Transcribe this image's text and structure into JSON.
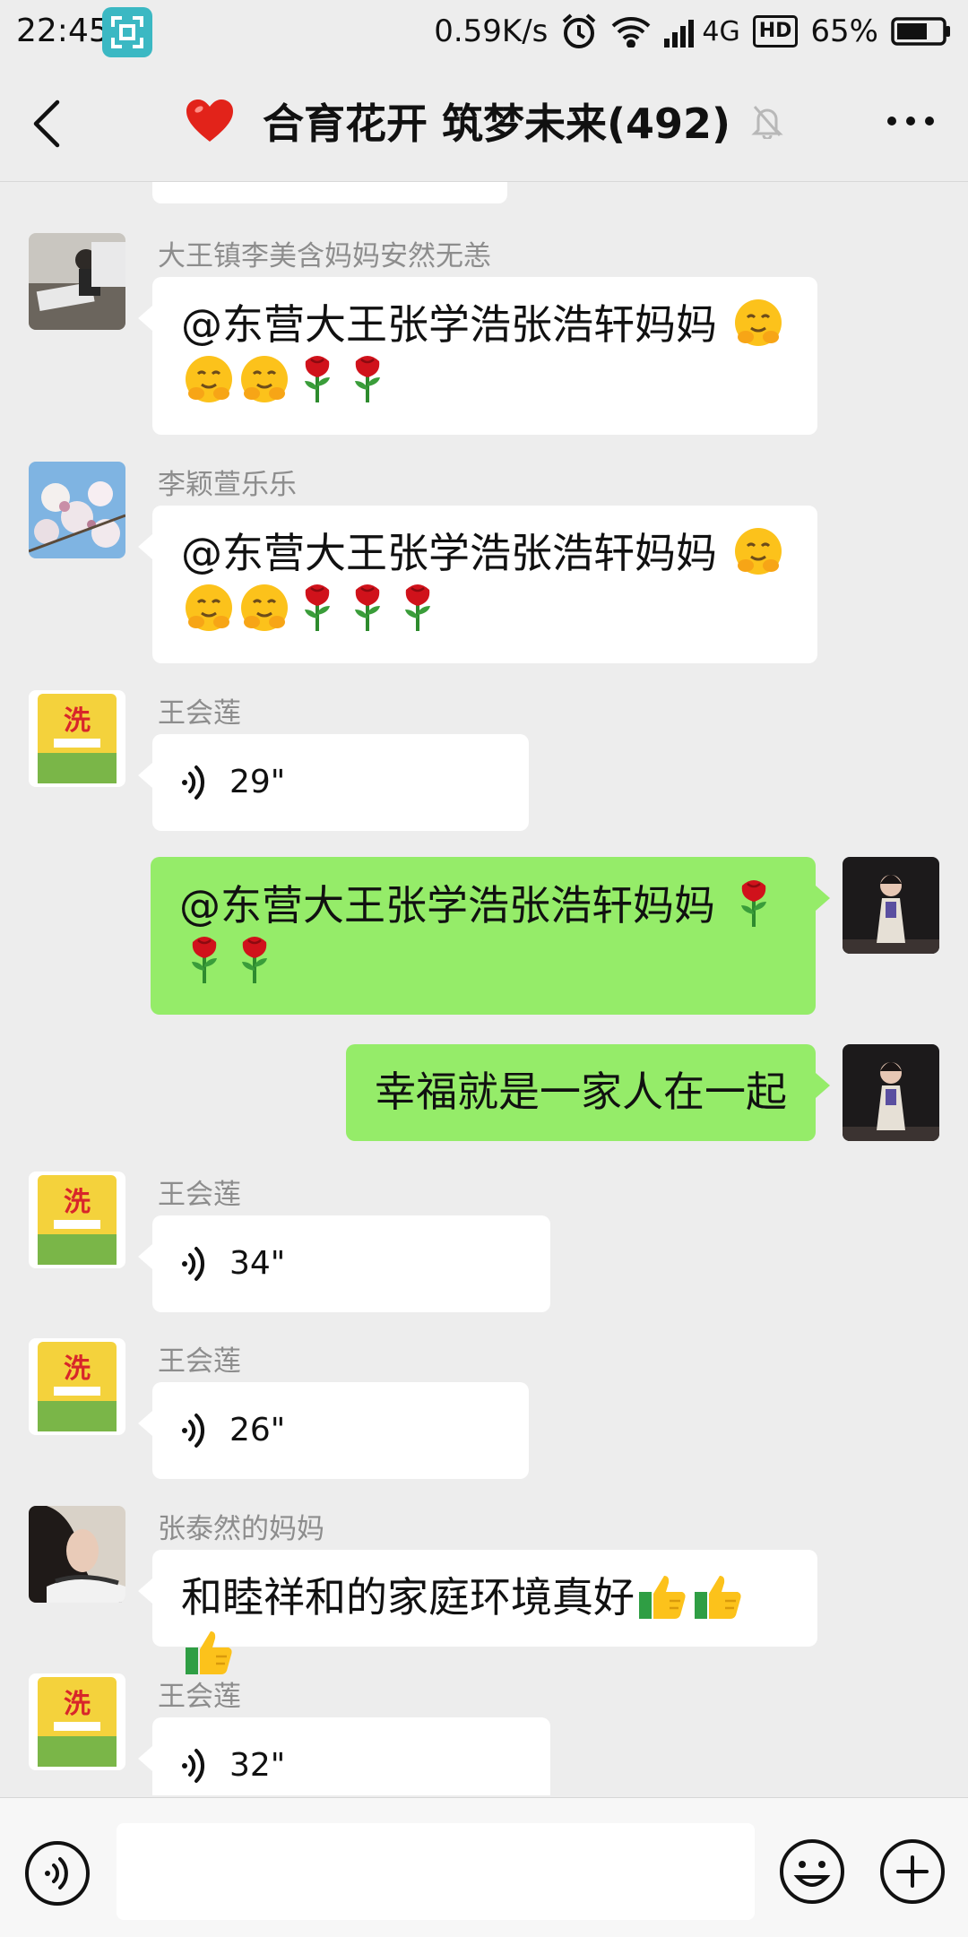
{
  "status_bar": {
    "time": "22:45",
    "net_speed": "0.59K/s",
    "network": "4G",
    "hd": "HD",
    "battery": "65%",
    "icons": [
      "scan-icon",
      "alarm-icon",
      "wifi-icon",
      "signal-icon",
      "battery-icon"
    ]
  },
  "header": {
    "title": "合育花开 筑梦未来(492)",
    "emoji": "heart",
    "muted": true,
    "colors": {
      "heart": "#e2231a"
    }
  },
  "colors": {
    "sent_bubble": "#95ec69",
    "received_bubble": "#ffffff",
    "background": "#ededed"
  },
  "messages": [
    {
      "side": "left",
      "type": "text",
      "sender": "大王镇李美含妈妈安然无恙",
      "text": "@东营大王张学浩张浩轩妈妈 ",
      "emojis": [
        "hug",
        "hug",
        "hug",
        "rose",
        "rose"
      ]
    },
    {
      "side": "left",
      "type": "text",
      "sender": "李颖萱乐乐",
      "text": "@东营大王张学浩张浩轩妈妈 ",
      "emojis": [
        "hug",
        "hug",
        "hug",
        "rose",
        "rose",
        "rose"
      ]
    },
    {
      "side": "left",
      "type": "voice",
      "sender": "王会莲",
      "duration": "29\""
    },
    {
      "side": "right",
      "type": "text",
      "text": "@东营大王张学浩张浩轩妈妈 ",
      "emojis": [
        "rose",
        "rose",
        "rose"
      ]
    },
    {
      "side": "right",
      "type": "text",
      "text": "幸福就是一家人在一起"
    },
    {
      "side": "left",
      "type": "voice",
      "sender": "王会莲",
      "duration": "34\""
    },
    {
      "side": "left",
      "type": "voice",
      "sender": "王会莲",
      "duration": "26\""
    },
    {
      "side": "left",
      "type": "text",
      "sender": "张泰然的妈妈",
      "text": "和睦祥和的家庭环境真好",
      "emojis": [
        "thumbs-up",
        "thumbs-up",
        "thumbs-up"
      ]
    },
    {
      "side": "left",
      "type": "voice",
      "sender": "王会莲",
      "duration": "32\""
    }
  ],
  "input_bar": {
    "placeholder": "",
    "icons": [
      "voice-input-icon",
      "emoji-icon",
      "plus-icon"
    ]
  }
}
